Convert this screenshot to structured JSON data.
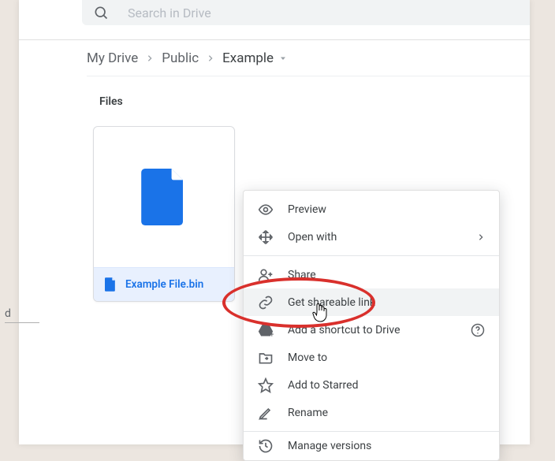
{
  "search": {
    "placeholder": "Search in Drive"
  },
  "breadcrumbs": {
    "a": "My Drive",
    "b": "Public",
    "c": "Example"
  },
  "section": {
    "files": "Files"
  },
  "file": {
    "name": "Example File.bin"
  },
  "sidebar": {
    "letter": "d"
  },
  "menu": {
    "preview": "Preview",
    "open_with": "Open with",
    "share": "Share",
    "get_link": "Get shareable link",
    "add_shortcut": "Add a shortcut to Drive",
    "move_to": "Move to",
    "add_star": "Add to Starred",
    "rename": "Rename",
    "manage_versions": "Manage versions"
  }
}
